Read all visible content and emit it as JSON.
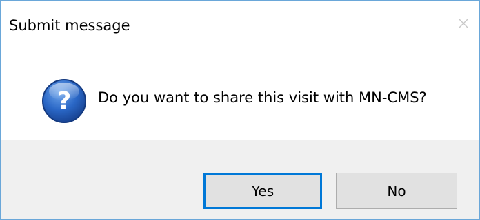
{
  "dialog": {
    "title": "Submit message",
    "close_icon": "close-icon",
    "icon": "question-icon",
    "message": "Do you want to share this visit with MN-CMS?",
    "buttons": {
      "yes_label": "Yes",
      "no_label": "No"
    },
    "colors": {
      "window_border": "#6aa7d9",
      "button_bar": "#f0f0f0",
      "default_button_border": "#0078d7",
      "question_icon_blue": "#1f5fb8"
    }
  }
}
